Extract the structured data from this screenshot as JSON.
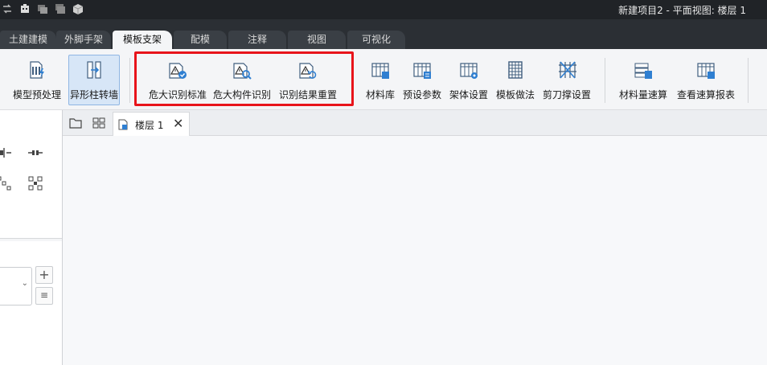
{
  "window": {
    "title": "新建项目2 - 平面视图: 楼层 1"
  },
  "quick_access": [
    "swap-icon",
    "structure-icon",
    "layers-icon",
    "stack-icon",
    "cube-icon"
  ],
  "tabs": [
    {
      "label": "土建建模",
      "active": false
    },
    {
      "label": "外脚手架",
      "active": false
    },
    {
      "label": "模板支架",
      "active": true
    },
    {
      "label": "配模",
      "active": false
    },
    {
      "label": "注释",
      "active": false
    },
    {
      "label": "视图",
      "active": false
    },
    {
      "label": "可视化",
      "active": false
    }
  ],
  "ribbon": {
    "model_preprocess": "模型预处理",
    "irregular_column_wall": "异形柱转墙",
    "danger_standard": "危大识别标准",
    "danger_component": "危大构件识别",
    "reset_result": "识别结果重置",
    "material_lib": "材料库",
    "preset_params": "预设参数",
    "frame_settings": "架体设置",
    "formwork_method": "模板做法",
    "scissor_brace": "剪刀撑设置",
    "material_quick_calc": "材料量速算",
    "view_quick_report": "查看速算报表"
  },
  "document": {
    "tab_label": "楼层 1"
  },
  "colors": {
    "accent": "#2f7fd1",
    "highlight": "#e8141b",
    "titlebar": "#202327"
  }
}
